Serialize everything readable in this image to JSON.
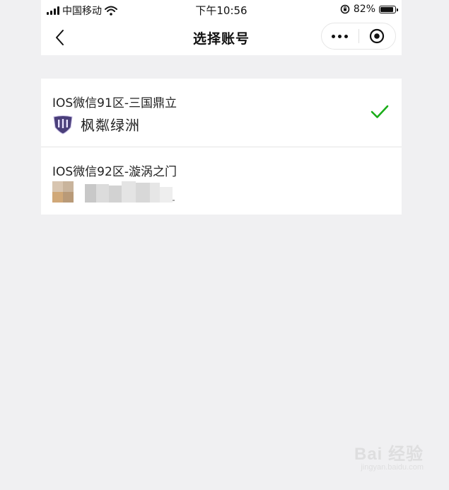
{
  "status_bar": {
    "carrier": "中国移动",
    "time": "下午10:56",
    "battery": "82%",
    "battery_level": 0.82
  },
  "nav": {
    "title": "选择账号"
  },
  "accounts": [
    {
      "server": "IOS微信91区-三国鼎立",
      "role_name": "枫粼绿洲",
      "selected": true
    },
    {
      "server": "IOS微信92区-漩涡之门",
      "role_name": "",
      "selected": false
    }
  ],
  "watermark": {
    "main": "Bai 经验",
    "sub": "jingyan.baidu.com"
  },
  "colors": {
    "check": "#1aad19",
    "background": "#f0f0f2",
    "emblem": "#4a3f7a"
  }
}
